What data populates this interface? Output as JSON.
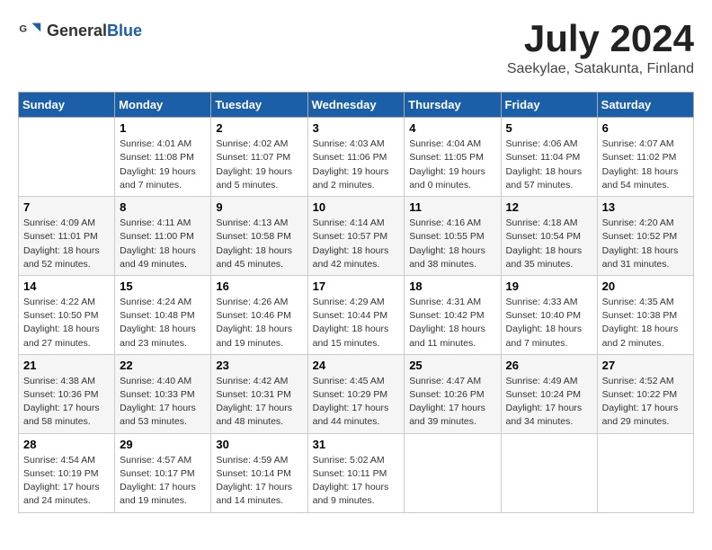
{
  "header": {
    "logo_general": "General",
    "logo_blue": "Blue",
    "month_year": "July 2024",
    "location": "Saekylae, Satakunta, Finland"
  },
  "weekdays": [
    "Sunday",
    "Monday",
    "Tuesday",
    "Wednesday",
    "Thursday",
    "Friday",
    "Saturday"
  ],
  "weeks": [
    [
      {
        "day": "",
        "sunrise": "",
        "sunset": "",
        "daylight": ""
      },
      {
        "day": "1",
        "sunrise": "Sunrise: 4:01 AM",
        "sunset": "Sunset: 11:08 PM",
        "daylight": "Daylight: 19 hours and 7 minutes."
      },
      {
        "day": "2",
        "sunrise": "Sunrise: 4:02 AM",
        "sunset": "Sunset: 11:07 PM",
        "daylight": "Daylight: 19 hours and 5 minutes."
      },
      {
        "day": "3",
        "sunrise": "Sunrise: 4:03 AM",
        "sunset": "Sunset: 11:06 PM",
        "daylight": "Daylight: 19 hours and 2 minutes."
      },
      {
        "day": "4",
        "sunrise": "Sunrise: 4:04 AM",
        "sunset": "Sunset: 11:05 PM",
        "daylight": "Daylight: 19 hours and 0 minutes."
      },
      {
        "day": "5",
        "sunrise": "Sunrise: 4:06 AM",
        "sunset": "Sunset: 11:04 PM",
        "daylight": "Daylight: 18 hours and 57 minutes."
      },
      {
        "day": "6",
        "sunrise": "Sunrise: 4:07 AM",
        "sunset": "Sunset: 11:02 PM",
        "daylight": "Daylight: 18 hours and 54 minutes."
      }
    ],
    [
      {
        "day": "7",
        "sunrise": "Sunrise: 4:09 AM",
        "sunset": "Sunset: 11:01 PM",
        "daylight": "Daylight: 18 hours and 52 minutes."
      },
      {
        "day": "8",
        "sunrise": "Sunrise: 4:11 AM",
        "sunset": "Sunset: 11:00 PM",
        "daylight": "Daylight: 18 hours and 49 minutes."
      },
      {
        "day": "9",
        "sunrise": "Sunrise: 4:13 AM",
        "sunset": "Sunset: 10:58 PM",
        "daylight": "Daylight: 18 hours and 45 minutes."
      },
      {
        "day": "10",
        "sunrise": "Sunrise: 4:14 AM",
        "sunset": "Sunset: 10:57 PM",
        "daylight": "Daylight: 18 hours and 42 minutes."
      },
      {
        "day": "11",
        "sunrise": "Sunrise: 4:16 AM",
        "sunset": "Sunset: 10:55 PM",
        "daylight": "Daylight: 18 hours and 38 minutes."
      },
      {
        "day": "12",
        "sunrise": "Sunrise: 4:18 AM",
        "sunset": "Sunset: 10:54 PM",
        "daylight": "Daylight: 18 hours and 35 minutes."
      },
      {
        "day": "13",
        "sunrise": "Sunrise: 4:20 AM",
        "sunset": "Sunset: 10:52 PM",
        "daylight": "Daylight: 18 hours and 31 minutes."
      }
    ],
    [
      {
        "day": "14",
        "sunrise": "Sunrise: 4:22 AM",
        "sunset": "Sunset: 10:50 PM",
        "daylight": "Daylight: 18 hours and 27 minutes."
      },
      {
        "day": "15",
        "sunrise": "Sunrise: 4:24 AM",
        "sunset": "Sunset: 10:48 PM",
        "daylight": "Daylight: 18 hours and 23 minutes."
      },
      {
        "day": "16",
        "sunrise": "Sunrise: 4:26 AM",
        "sunset": "Sunset: 10:46 PM",
        "daylight": "Daylight: 18 hours and 19 minutes."
      },
      {
        "day": "17",
        "sunrise": "Sunrise: 4:29 AM",
        "sunset": "Sunset: 10:44 PM",
        "daylight": "Daylight: 18 hours and 15 minutes."
      },
      {
        "day": "18",
        "sunrise": "Sunrise: 4:31 AM",
        "sunset": "Sunset: 10:42 PM",
        "daylight": "Daylight: 18 hours and 11 minutes."
      },
      {
        "day": "19",
        "sunrise": "Sunrise: 4:33 AM",
        "sunset": "Sunset: 10:40 PM",
        "daylight": "Daylight: 18 hours and 7 minutes."
      },
      {
        "day": "20",
        "sunrise": "Sunrise: 4:35 AM",
        "sunset": "Sunset: 10:38 PM",
        "daylight": "Daylight: 18 hours and 2 minutes."
      }
    ],
    [
      {
        "day": "21",
        "sunrise": "Sunrise: 4:38 AM",
        "sunset": "Sunset: 10:36 PM",
        "daylight": "Daylight: 17 hours and 58 minutes."
      },
      {
        "day": "22",
        "sunrise": "Sunrise: 4:40 AM",
        "sunset": "Sunset: 10:33 PM",
        "daylight": "Daylight: 17 hours and 53 minutes."
      },
      {
        "day": "23",
        "sunrise": "Sunrise: 4:42 AM",
        "sunset": "Sunset: 10:31 PM",
        "daylight": "Daylight: 17 hours and 48 minutes."
      },
      {
        "day": "24",
        "sunrise": "Sunrise: 4:45 AM",
        "sunset": "Sunset: 10:29 PM",
        "daylight": "Daylight: 17 hours and 44 minutes."
      },
      {
        "day": "25",
        "sunrise": "Sunrise: 4:47 AM",
        "sunset": "Sunset: 10:26 PM",
        "daylight": "Daylight: 17 hours and 39 minutes."
      },
      {
        "day": "26",
        "sunrise": "Sunrise: 4:49 AM",
        "sunset": "Sunset: 10:24 PM",
        "daylight": "Daylight: 17 hours and 34 minutes."
      },
      {
        "day": "27",
        "sunrise": "Sunrise: 4:52 AM",
        "sunset": "Sunset: 10:22 PM",
        "daylight": "Daylight: 17 hours and 29 minutes."
      }
    ],
    [
      {
        "day": "28",
        "sunrise": "Sunrise: 4:54 AM",
        "sunset": "Sunset: 10:19 PM",
        "daylight": "Daylight: 17 hours and 24 minutes."
      },
      {
        "day": "29",
        "sunrise": "Sunrise: 4:57 AM",
        "sunset": "Sunset: 10:17 PM",
        "daylight": "Daylight: 17 hours and 19 minutes."
      },
      {
        "day": "30",
        "sunrise": "Sunrise: 4:59 AM",
        "sunset": "Sunset: 10:14 PM",
        "daylight": "Daylight: 17 hours and 14 minutes."
      },
      {
        "day": "31",
        "sunrise": "Sunrise: 5:02 AM",
        "sunset": "Sunset: 10:11 PM",
        "daylight": "Daylight: 17 hours and 9 minutes."
      },
      {
        "day": "",
        "sunrise": "",
        "sunset": "",
        "daylight": ""
      },
      {
        "day": "",
        "sunrise": "",
        "sunset": "",
        "daylight": ""
      },
      {
        "day": "",
        "sunrise": "",
        "sunset": "",
        "daylight": ""
      }
    ]
  ]
}
